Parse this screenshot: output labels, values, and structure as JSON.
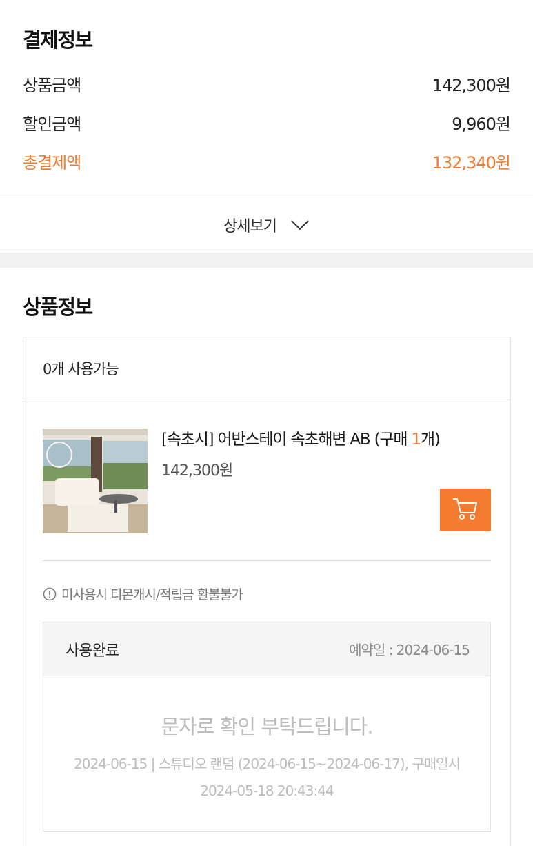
{
  "payment": {
    "title": "결제정보",
    "rows": [
      {
        "label": "상품금액",
        "value": "142,300원"
      },
      {
        "label": "할인금액",
        "value": "9,960원"
      },
      {
        "label": "총결제액",
        "value": "132,340원"
      }
    ],
    "detail_label": "상세보기"
  },
  "product_section": {
    "title": "상품정보",
    "availability": "0개 사용가능",
    "product": {
      "name": "[속초시] 어반스테이 속초해변 AB (구매 ",
      "qty": "1",
      "qty_suffix": "개)",
      "price": "142,300원"
    },
    "notice": "미사용시 티몬캐시/적립금 환불불가",
    "usage": {
      "status": "사용완료",
      "reservation": "예약일 : 2024-06-15",
      "message": "문자로 확인 부탁드립니다.",
      "detail": "2024-06-15 | 스튜디오 랜덤 (2024-06-15~2024-06-17), 구매일시 2024-05-18 20:43:44"
    }
  },
  "colors": {
    "accent": "#f37b30",
    "divider": "#e2e2e2",
    "band": "#f1f1f1"
  },
  "icons": [
    "chevron-down-icon",
    "cart-icon",
    "info-circle-icon"
  ]
}
